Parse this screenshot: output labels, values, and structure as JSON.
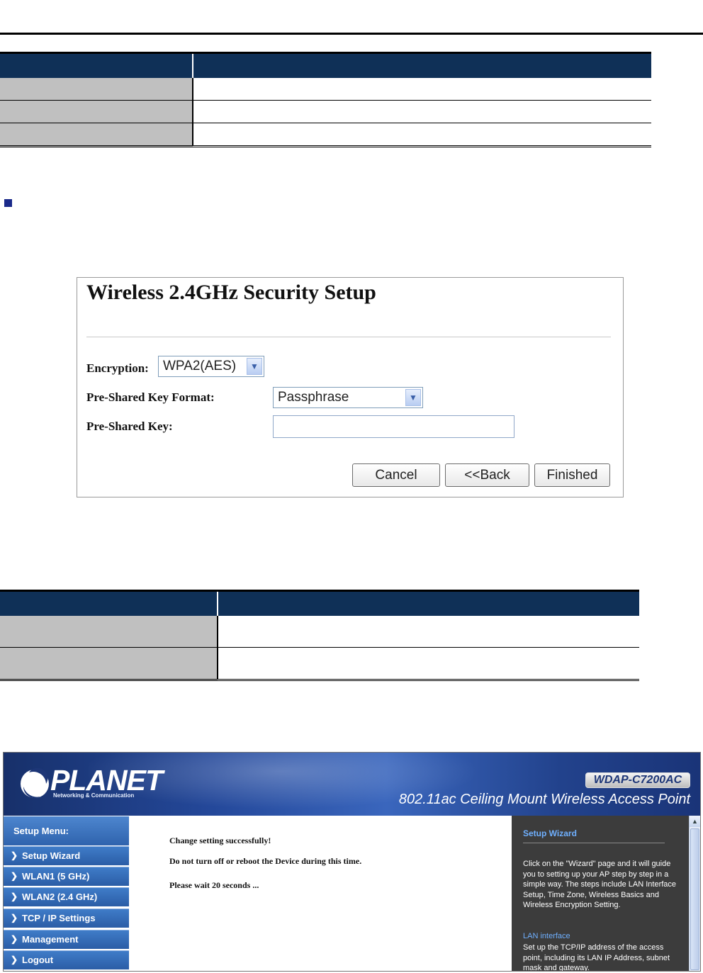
{
  "setup": {
    "title": "Wireless 2.4GHz Security Setup",
    "encryption_label": "Encryption:",
    "encryption_value": "WPA2(AES)",
    "psk_format_label": "Pre-Shared Key Format:",
    "psk_format_value": "Passphrase",
    "psk_label": "Pre-Shared Key:",
    "psk_value": "",
    "buttons": {
      "cancel": "Cancel",
      "back": "<<Back",
      "finished": "Finished"
    }
  },
  "webui": {
    "logo": "PLANET",
    "logo_sub": "Networking & Communication",
    "model": "WDAP-C7200AC",
    "product_title": "802.11ac Ceiling Mount Wireless Access Point",
    "menu_header": "Setup Menu:",
    "menu_items": [
      {
        "label": "Setup Wizard"
      },
      {
        "label": "WLAN1 (5 GHz)"
      },
      {
        "label": "WLAN2 (2.4 GHz)"
      },
      {
        "label": "TCP / IP Settings"
      },
      {
        "label": "Management"
      },
      {
        "label": "Logout"
      }
    ],
    "messages": {
      "success": "Change setting successfully!",
      "warning": "Do not turn off or reboot the Device during this time.",
      "wait": "Please wait 20 seconds ..."
    },
    "help": {
      "title": "Setup Wizard",
      "wizard_text": "Click on the \"Wizard\" page and it will guide you to setting up your AP step by step in a simple way. The steps include LAN Interface Setup, Time Zone, Wireless Basics and Wireless Encryption Setting.",
      "lan_title": "LAN interface",
      "lan_text": "Set up the TCP/IP address of the access point, including its LAN IP Address, subnet mask and gateway."
    }
  },
  "colors": {
    "table_header": "#0f3057",
    "table_key_cell": "#c0c0c0",
    "menu_blue": "#2f63ad",
    "help_panel": "#3c3c3c"
  }
}
